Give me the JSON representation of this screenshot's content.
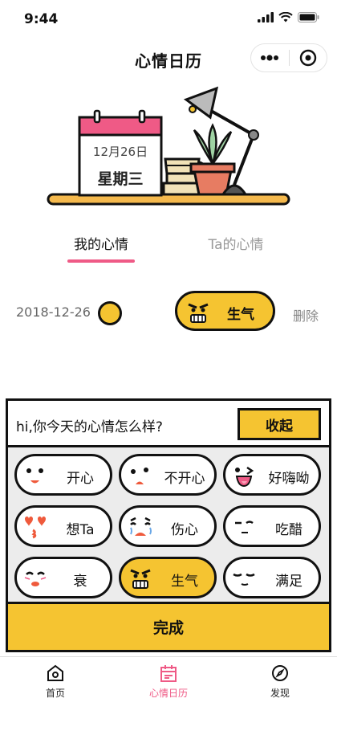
{
  "status_bar": {
    "time": "9:44"
  },
  "nav": {
    "title": "心情日历"
  },
  "calendar_card": {
    "date": "12月26日",
    "weekday": "星期三"
  },
  "tabs": [
    {
      "label": "我的心情",
      "active": true
    },
    {
      "label": "Ta的心情",
      "active": false
    }
  ],
  "record": {
    "date": "2018-12-26",
    "mood": "生气",
    "delete_label": "删除"
  },
  "panel": {
    "question": "hi,你今天的心情怎么样?",
    "collapse_label": "收起",
    "done_label": "完成",
    "moods": [
      {
        "label": "开心",
        "icon": "happy-face-icon",
        "selected": false
      },
      {
        "label": "不开心",
        "icon": "unhappy-face-icon",
        "selected": false
      },
      {
        "label": "好嗨呦",
        "icon": "excited-face-icon",
        "selected": false
      },
      {
        "label": "想Ta",
        "icon": "missing-face-icon",
        "selected": false
      },
      {
        "label": "伤心",
        "icon": "crying-face-icon",
        "selected": false
      },
      {
        "label": "吃醋",
        "icon": "jealous-face-icon",
        "selected": false
      },
      {
        "label": "衰",
        "icon": "unlucky-face-icon",
        "selected": false
      },
      {
        "label": "生气",
        "icon": "angry-face-icon",
        "selected": true
      },
      {
        "label": "满足",
        "icon": "satisfied-face-icon",
        "selected": false
      }
    ]
  },
  "tabbar": {
    "items": [
      {
        "label": "首页",
        "icon": "home-icon",
        "active": false
      },
      {
        "label": "心情日历",
        "icon": "calendar-icon",
        "active": true
      },
      {
        "label": "发现",
        "icon": "compass-icon",
        "active": false
      }
    ]
  },
  "colors": {
    "accent_yellow": "#f5c431",
    "accent_pink": "#ef5a86"
  }
}
